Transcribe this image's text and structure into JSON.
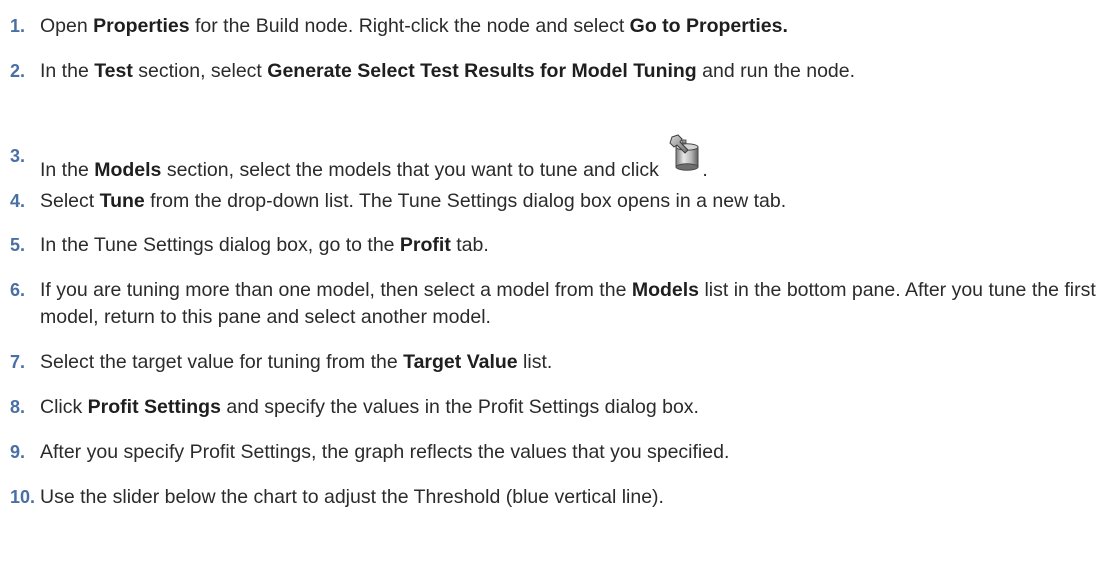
{
  "steps": [
    {
      "number": "1.",
      "t1": "Open ",
      "b1": "Properties",
      "t2": " for the Build node. Right-click the node and select ",
      "b2": "Go to Properties."
    },
    {
      "number": "2.",
      "t1": "In the ",
      "b1": "Test",
      "t2": " section, select ",
      "b2": "Generate Select Test Results for Model Tuning",
      "t3": " and run the node."
    },
    {
      "number": "3.",
      "t1": "In the ",
      "b1": "Models",
      "t2": " section, select the models that you want to tune and click ",
      "t3": ".",
      "icon": "tune-models-icon"
    },
    {
      "number": "4.",
      "t1": "Select ",
      "b1": "Tune",
      "t2": " from the drop-down list. The Tune Settings dialog box opens in a new tab."
    },
    {
      "number": "5.",
      "t1": "In the Tune Settings dialog box, go to the ",
      "b1": "Profit",
      "t2": " tab."
    },
    {
      "number": "6.",
      "t1": "If you are tuning more than one model, then select a model from the ",
      "b1": "Models",
      "t2": " list in the bottom pane. After you tune the first model, return to this pane and select another model."
    },
    {
      "number": "7.",
      "t1": "Select the target value for tuning from the ",
      "b1": "Target Value",
      "t2": " list."
    },
    {
      "number": "8.",
      "t1": "Click ",
      "b1": "Profit Settings",
      "t2": " and specify the values in the Profit Settings dialog box."
    },
    {
      "number": "9.",
      "t1": "After you specify Profit Settings, the graph reflects the values that you specified."
    },
    {
      "number": "10.",
      "t1": "Use the slider below the chart to adjust the Threshold (blue vertical line)."
    }
  ],
  "colors": {
    "step_number": "#4a6fa5",
    "text": "#2b2b2b"
  }
}
